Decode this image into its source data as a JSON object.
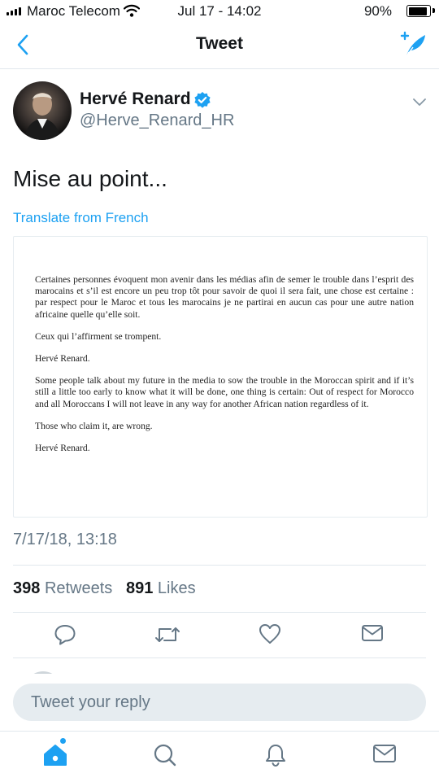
{
  "status_bar": {
    "carrier": "Maroc Telecom",
    "time": "Jul 17 - 14:02",
    "battery_percent": "90%",
    "battery_level": 0.9
  },
  "nav": {
    "title": "Tweet",
    "back_icon": "chevron-left-icon",
    "compose_icon": "compose-tweet-icon"
  },
  "author": {
    "name": "Hervé Renard",
    "handle": "@Herve_Renard_HR",
    "verified": true
  },
  "tweet": {
    "text": "Mise au point...",
    "translate_label": "Translate from French",
    "timestamp": "7/17/18, 13:18"
  },
  "statement": {
    "para_fr_1": "Certaines personnes évoquent mon avenir dans les médias afin de semer le trouble dans l’esprit des marocains et s’il est encore un peu trop tôt pour savoir de quoi il sera fait, une chose est certaine : par respect pour le Maroc et tous les marocains je ne partirai en aucun cas pour une autre nation africaine quelle qu’elle soit.",
    "para_fr_2": "Ceux qui l’affirment se trompent.",
    "signature_fr": "Hervé Renard.",
    "para_en_1": "Some people talk about my future in the media to sow the trouble in the Moroccan spirit and if it’s still a little too early to know what it will be done, one thing is certain: Out of respect for Morocco and all Moroccans I will not leave in any way for another African nation regardless of it.",
    "para_en_2": "Those who claim it, are wrong.",
    "signature_en": "Hervé Renard."
  },
  "stats": {
    "retweets_count": "398",
    "retweets_label": "Retweets",
    "likes_count": "891",
    "likes_label": "Likes"
  },
  "reply": {
    "placeholder": "Tweet your reply"
  },
  "colors": {
    "accent": "#1da1f2",
    "secondary_text": "#657786",
    "primary_text": "#14171a",
    "divider": "#e1e8ed"
  }
}
